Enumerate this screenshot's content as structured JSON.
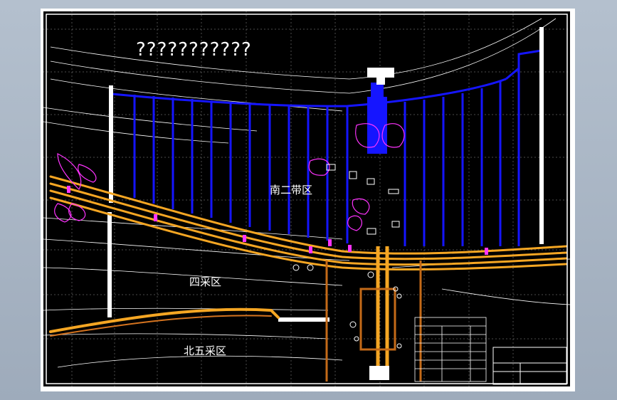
{
  "drawing": {
    "title_text": "???????????",
    "zones": {
      "south_zone": "南二带区",
      "fourth_zone": "四采区",
      "north_zone": "北五采区"
    }
  },
  "colors": {
    "background": "#000000",
    "contour": "#ffffff",
    "roadway": "#f5a623",
    "workface": "#1515ff",
    "marker": "#ff33ff"
  }
}
